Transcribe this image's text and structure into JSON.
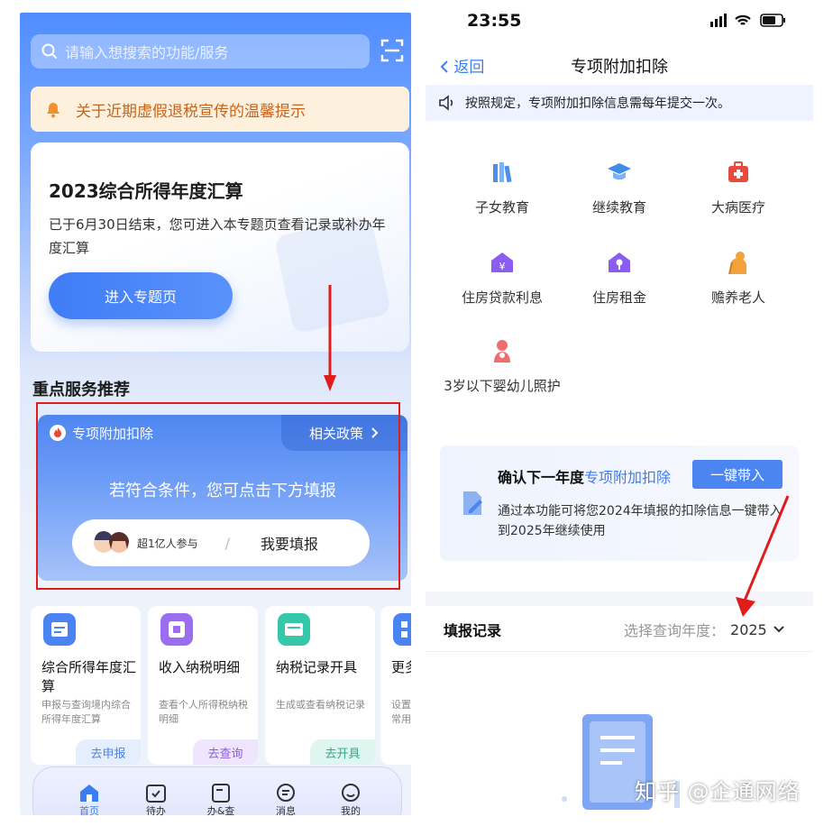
{
  "left": {
    "search_placeholder": "请输入想搜索的功能/服务",
    "notice_text": "关于近期虚假退税宣传的温馨提示",
    "card": {
      "title": "2023综合所得年度汇算",
      "desc": "已于6月30日结束，您可进入本专题页查看记录或补办年度汇算",
      "button": "进入专题页"
    },
    "section_title": "重点服务推荐",
    "feature": {
      "label": "专项附加扣除",
      "policy": "相关政策",
      "message": "若符合条件，您可点击下方填报",
      "participants": "超1亿人参与",
      "fill_button": "我要填报"
    },
    "tiles": [
      {
        "title": "综合所得年度汇算",
        "desc": "申报与查询境内综合所得年度汇算",
        "go": "去申报",
        "color": "#4a84f2"
      },
      {
        "title": "收入纳税明细",
        "desc": "查看个人所得税纳税明细",
        "go": "去查询",
        "color": "#9b6ef0"
      },
      {
        "title": "纳税记录开具",
        "desc": "生成或查看纳税记录",
        "go": "去开具",
        "color": "#36c7a8"
      },
      {
        "title": "更多",
        "desc": "设置常用",
        "go": "",
        "color": "#4a84f2"
      }
    ],
    "tabs": [
      "首页",
      "待办",
      "办&查",
      "消息",
      "我的"
    ]
  },
  "right": {
    "status_time": "23:55",
    "back_label": "返回",
    "nav_title": "专项附加扣除",
    "announcement": "按照规定，专项附加扣除信息需每年提交一次。",
    "grid": [
      {
        "label": "子女教育",
        "color": "#4a8fe8"
      },
      {
        "label": "继续教育",
        "color": "#3d8ce6"
      },
      {
        "label": "大病医疗",
        "color": "#e84a3d"
      },
      {
        "label": "住房贷款利息",
        "color": "#8a5cf0"
      },
      {
        "label": "住房租金",
        "color": "#8a5cf0"
      },
      {
        "label": "赡养老人",
        "color": "#f2a23a"
      },
      {
        "label": "3岁以下婴幼儿照护",
        "color": "#ef6d6d"
      }
    ],
    "confirm": {
      "title_prefix": "确认下一年度",
      "title_highlight": "专项附加扣除",
      "button": "一键带入",
      "desc": "通过本功能可将您2024年填报的扣除信息一键带入到2025年继续使用"
    },
    "records_label": "填报记录",
    "year_label": "选择查询年度：",
    "year_value": "2025"
  },
  "watermark": "知乎 @企通网络"
}
